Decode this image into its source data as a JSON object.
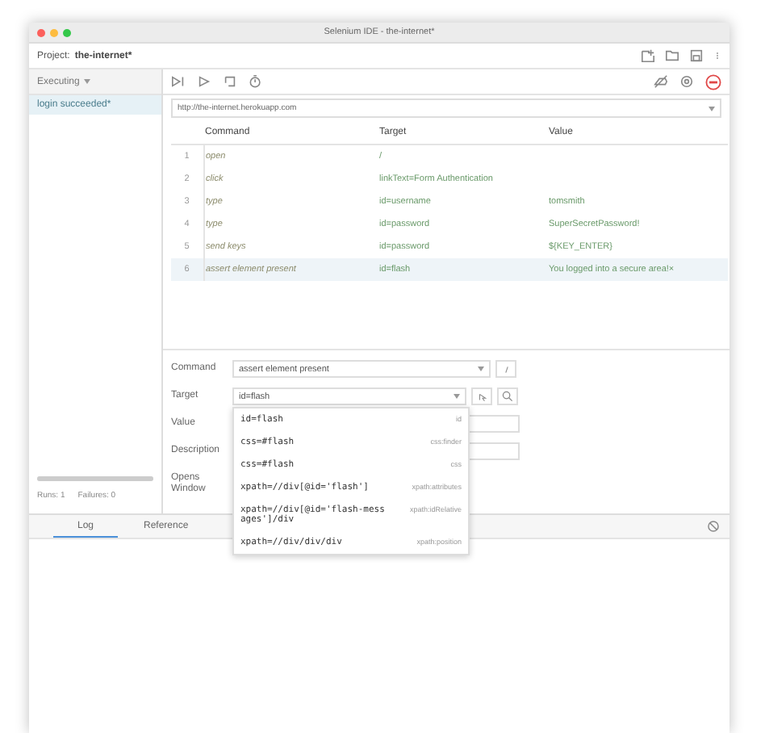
{
  "window": {
    "title": "Selenium IDE - the-internet*"
  },
  "project": {
    "label": "Project:",
    "name": "the-internet*"
  },
  "suite_select": {
    "value": "Executing"
  },
  "tests": [
    {
      "name": "login succeeded*",
      "selected": true
    }
  ],
  "status": {
    "runs": "Runs: 1",
    "failures": "Failures: 0",
    "level": 1
  },
  "url": {
    "value": "http://the-internet.herokuapp.com"
  },
  "table": {
    "columns": [
      "Command",
      "Target",
      "Value"
    ],
    "rows": [
      {
        "index": "1",
        "command": "open",
        "target": "/",
        "selected": false
      },
      {
        "index": "2",
        "command": "click",
        "target": "linkText=Form Authentication",
        "selected": false
      },
      {
        "index": "3",
        "command": "type",
        "target": "id=username",
        "value": "tomsmith",
        "selected": false
      },
      {
        "index": "4",
        "command": "type",
        "target": "id=password",
        "value": "SuperSecretPassword!",
        "selected": false
      },
      {
        "index": "5",
        "command": "send keys",
        "target": "id=password",
        "value": "${KEY_ENTER}",
        "selected": false
      },
      {
        "index": "6",
        "command": "assert element present",
        "target": "id=flash",
        "value": "You logged into a secure area!×",
        "selected": true
      }
    ]
  },
  "editor": {
    "fields": [
      {
        "kind": "select",
        "label": "Command",
        "value": "assert element present"
      },
      {
        "kind": "locator",
        "label": "Target",
        "value": "id=flash"
      },
      {
        "kind": "text",
        "label": "Value"
      },
      {
        "kind": "text",
        "label": "Description"
      },
      {
        "kind": "none",
        "label": "Opens Window"
      }
    ]
  },
  "locator_suggestions": [
    {
      "locator": "id=flash",
      "strategy": "id"
    },
    {
      "locator": "css=#flash",
      "strategy": "css:finder"
    },
    {
      "locator": "css=#flash",
      "strategy": "css"
    },
    {
      "locator": "xpath=//div[@id='flash']",
      "strategy": "xpath:attributes"
    },
    {
      "locator": "xpath=//div[@id='flash-messages']/div",
      "strategy": "xpath:idRelative"
    },
    {
      "locator": "xpath=//div/div/div",
      "strategy": "xpath:position"
    }
  ],
  "log_tabs": [
    {
      "label": "Log",
      "selected": true
    },
    {
      "label": "Reference",
      "selected": false
    }
  ]
}
